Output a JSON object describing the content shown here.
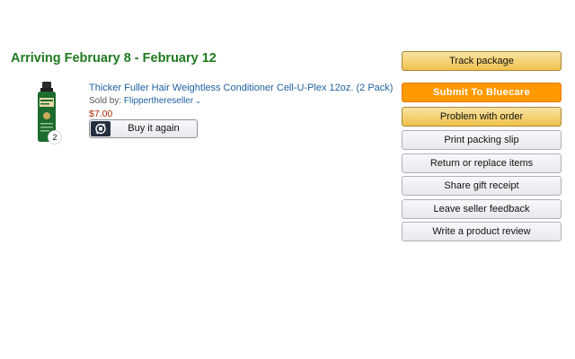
{
  "shipment": {
    "arrival_text": "Arriving February 8 - February 12"
  },
  "item": {
    "title": "Thicker Fuller Hair Weightless Conditioner Cell-U-Plex 12oz. (2 Pack)",
    "sold_by_label": "Sold by:",
    "seller_name": "Flipperthereseller",
    "price": "$7.00",
    "quantity_badge": "2",
    "buy_again_label": "Buy it again",
    "image_icon": "conditioner-bottle",
    "buy_again_icon": "buy-again-refresh-icon"
  },
  "actions": {
    "track_package": "Track package",
    "submit_bluecare": "Submit To Bluecare",
    "problem_with_order": "Problem with order",
    "print_packing_slip": "Print packing slip",
    "return_or_replace": "Return or replace items",
    "share_gift_receipt": "Share gift receipt",
    "leave_seller_feedback": "Leave seller feedback",
    "write_product_review": "Write a product review"
  },
  "colors": {
    "arrival_green": "#1e7a1e",
    "link_blue": "#2162a1",
    "price_red": "#b12704",
    "yellow_button": "#f0c14b",
    "orange_button": "#ff9900"
  }
}
